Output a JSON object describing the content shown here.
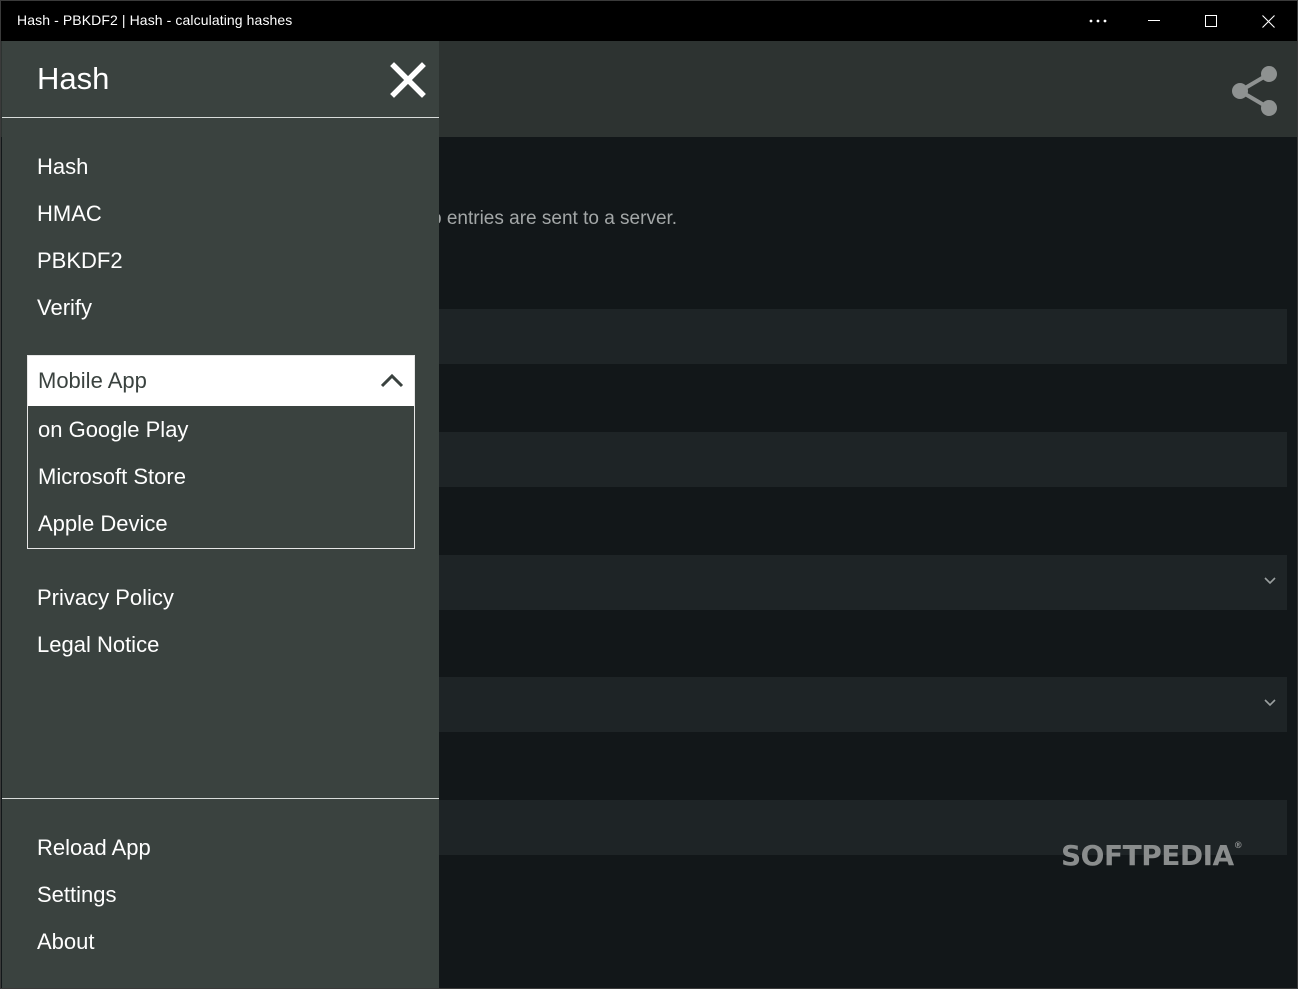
{
  "window": {
    "title": "Hash - PBKDF2 | Hash - calculating hashes",
    "controls": [
      "more-icon",
      "minimize-icon",
      "maximize-icon",
      "close-icon"
    ]
  },
  "background": {
    "privacy_text": "o entries are sent to a server.",
    "share_icon": "share-icon",
    "watermark": "SOFTPEDIA",
    "watermark_mark": "®"
  },
  "drawer": {
    "title": "Hash",
    "close_icon": "close-x-icon",
    "nav": [
      {
        "label": "Hash"
      },
      {
        "label": "HMAC"
      },
      {
        "label": "PBKDF2"
      },
      {
        "label": "Verify"
      }
    ],
    "mobile_app": {
      "label": "Mobile App",
      "expanded": true,
      "items": [
        {
          "label": "on Google Play"
        },
        {
          "label": "Microsoft Store"
        },
        {
          "label": "Apple Device"
        }
      ]
    },
    "legal": [
      {
        "label": "Privacy Policy"
      },
      {
        "label": "Legal Notice"
      }
    ],
    "footer": [
      {
        "label": "Reload App"
      },
      {
        "label": "Settings"
      },
      {
        "label": "About"
      }
    ]
  },
  "colors": {
    "drawer_bg": "#3a423f",
    "header_bg": "#2d3331",
    "content_bg": "#121719",
    "field_bg": "#1e2426",
    "text": "#ffffff"
  }
}
